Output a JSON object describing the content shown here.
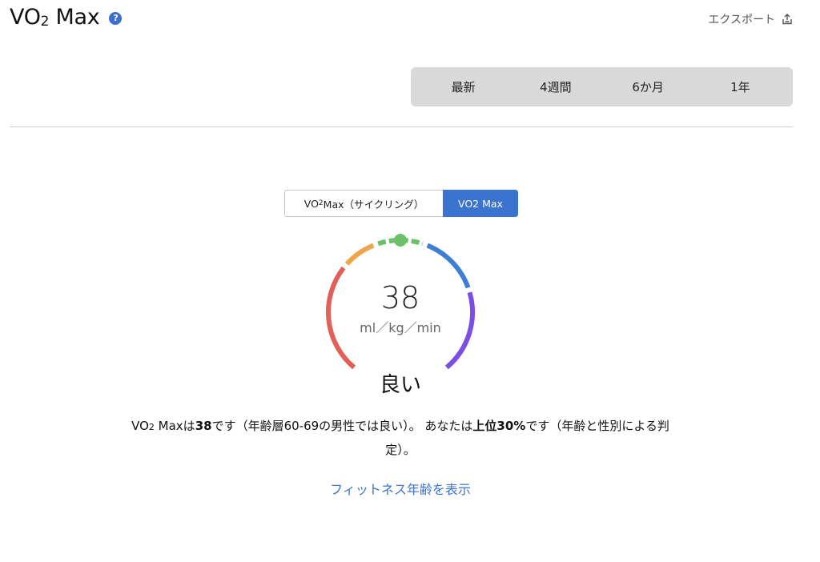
{
  "header": {
    "title_main": "VO",
    "title_sub": "2",
    "title_rest": " Max",
    "help_glyph": "?",
    "export_label": "エクスポート"
  },
  "periods": [
    {
      "label": "最新",
      "active": true
    },
    {
      "label": "4週間",
      "active": false
    },
    {
      "label": "6か月",
      "active": false
    },
    {
      "label": "1年",
      "active": false
    }
  ],
  "toggle": {
    "cycling_main": "VO",
    "cycling_sub": "2",
    "cycling_rest": " Max（サイクリング）",
    "run_label": "VO2 Max"
  },
  "gauge": {
    "value": "38",
    "unit": "ml／kg／min",
    "rating": "良い",
    "level": 0.5,
    "colors": {
      "poor": "#e2605a",
      "fair": "#eea54b",
      "good": "#6cc06a",
      "excellent": "#3d7fd4",
      "superior": "#7b4ee6"
    }
  },
  "summary": {
    "p1_main": "VO",
    "p1_sub": "2",
    "p1_rest": " Maxは",
    "p1_value": "38",
    "p1_tail": "です（年齢層60-69の男性では良い）。 あなたは",
    "p1_rank": "上位30%",
    "p1_end": "です（年齢と性別による判定）。"
  },
  "links": {
    "fitness_age": "フィットネス年齢を表示"
  },
  "colors": {
    "accent": "#3b74d0",
    "segment_bg": "#d9d9d9"
  }
}
